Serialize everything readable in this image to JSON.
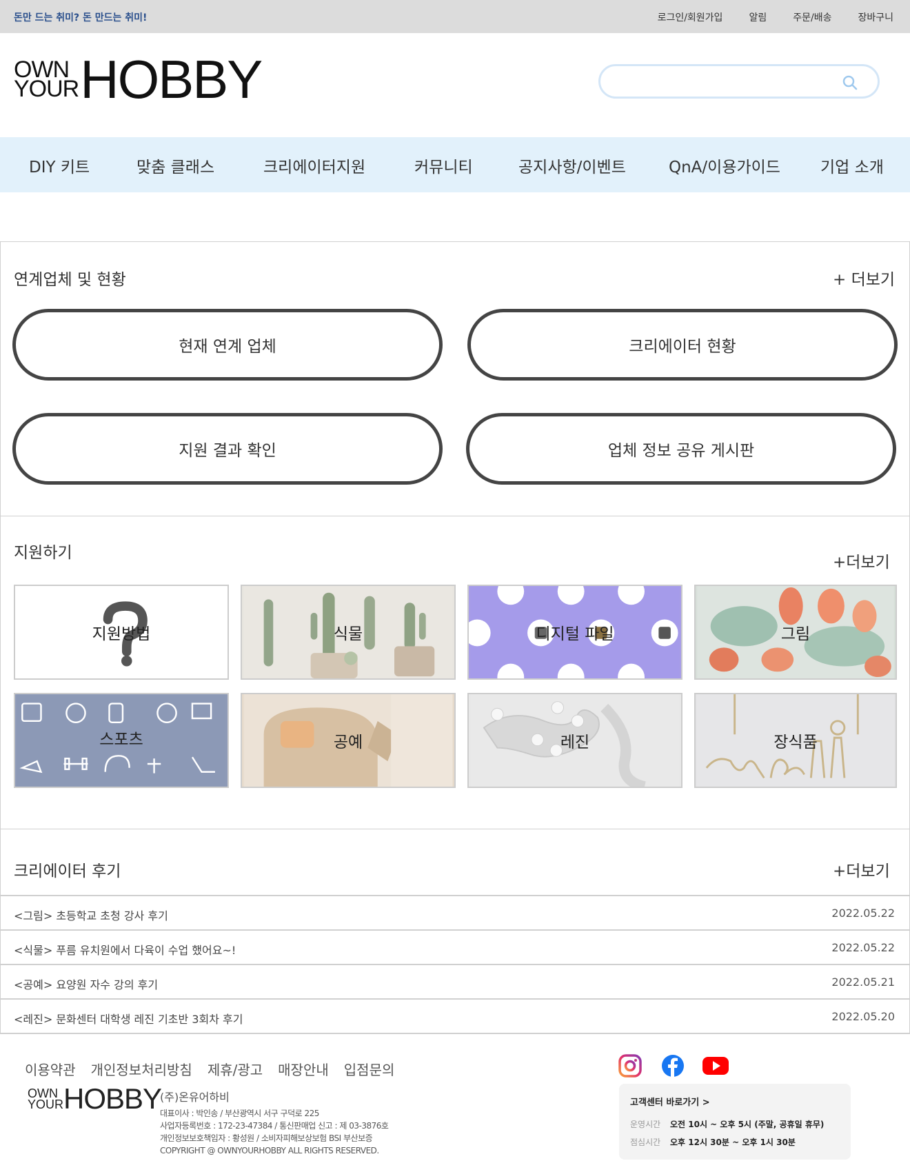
{
  "topbar": {
    "slogan": "돈만 드는 취미? 돈 만드는 취미!",
    "links": [
      "로그인/회원가입",
      "알림",
      "주문/배송",
      "장바구니"
    ]
  },
  "logo": {
    "own": "OWN",
    "your": "YOUR",
    "hobby": "HOBBY"
  },
  "search": {
    "placeholder": "",
    "icon": "search-icon"
  },
  "nav": [
    "DIY 키트",
    "맞춤 클래스",
    "크리에이터지원",
    "커뮤니티",
    "공지사항/이벤트",
    "QnA/이용가이드",
    "기업 소개"
  ],
  "partners": {
    "title": "연계업체 및 현황",
    "more": "+ 더보기",
    "buttons": [
      "현재 연계 업체",
      "크리에이터 현황",
      "지원 결과 확인",
      "업체 정보 공유 게시판"
    ]
  },
  "apply": {
    "title": "지원하기",
    "more": "+더보기",
    "tiles": [
      "지원방법",
      "식물",
      "디지털 파일",
      "그림",
      "스포츠",
      "공예",
      "레진",
      "장식품"
    ]
  },
  "reviews": {
    "title": "크리에이터 후기",
    "more": "+더보기",
    "items": [
      {
        "title": "<그림> 초등학교 초청 강사 후기",
        "date": "2022.05.22"
      },
      {
        "title": "<식물> 푸름 유치원에서 다육이 수업 했어요~!",
        "date": "2022.05.22"
      },
      {
        "title": "<공예> 요양원 자수 강의 후기",
        "date": "2022.05.21"
      },
      {
        "title": "<레진> 문화센터 대학생 레진 기초반 3회차 후기",
        "date": "2022.05.20"
      }
    ]
  },
  "footer": {
    "links": [
      "이용약관",
      "개인정보처리방침",
      "제휴/광고",
      "매장안내",
      "입점문의"
    ],
    "company": "(주)온유어하비",
    "info": [
      "대표이사 : 박인송 / 부산광역시 서구 구덕로 225",
      "사업자등록번호 : 172-23-47384 / 통신판매업 신고 : 제 03-3876호",
      "개인정보보호책임자 : 황성원 / 소비자피해보상보험 BSI 부산보증",
      "COPYRIGHT @ OWNYOURHOBBY ALL RIGHTS RESERVED."
    ],
    "social": [
      "instagram-icon",
      "facebook-icon",
      "youtube-icon"
    ],
    "cs": {
      "title": "고객센터 바로가기 >",
      "hours_label": "운영시간",
      "hours": "오전 10시 ~ 오후 5시 (주말, 공휴일 휴무)",
      "lunch_label": "점심시간",
      "lunch": "오후 12시 30분 ~ 오후 1시 30분"
    }
  },
  "colors": {
    "nav_bg": "#e2f1fb",
    "topbar_bg": "#dcdcdc",
    "slogan": "#2a4f8c",
    "search_border": "#d4e6f7"
  }
}
